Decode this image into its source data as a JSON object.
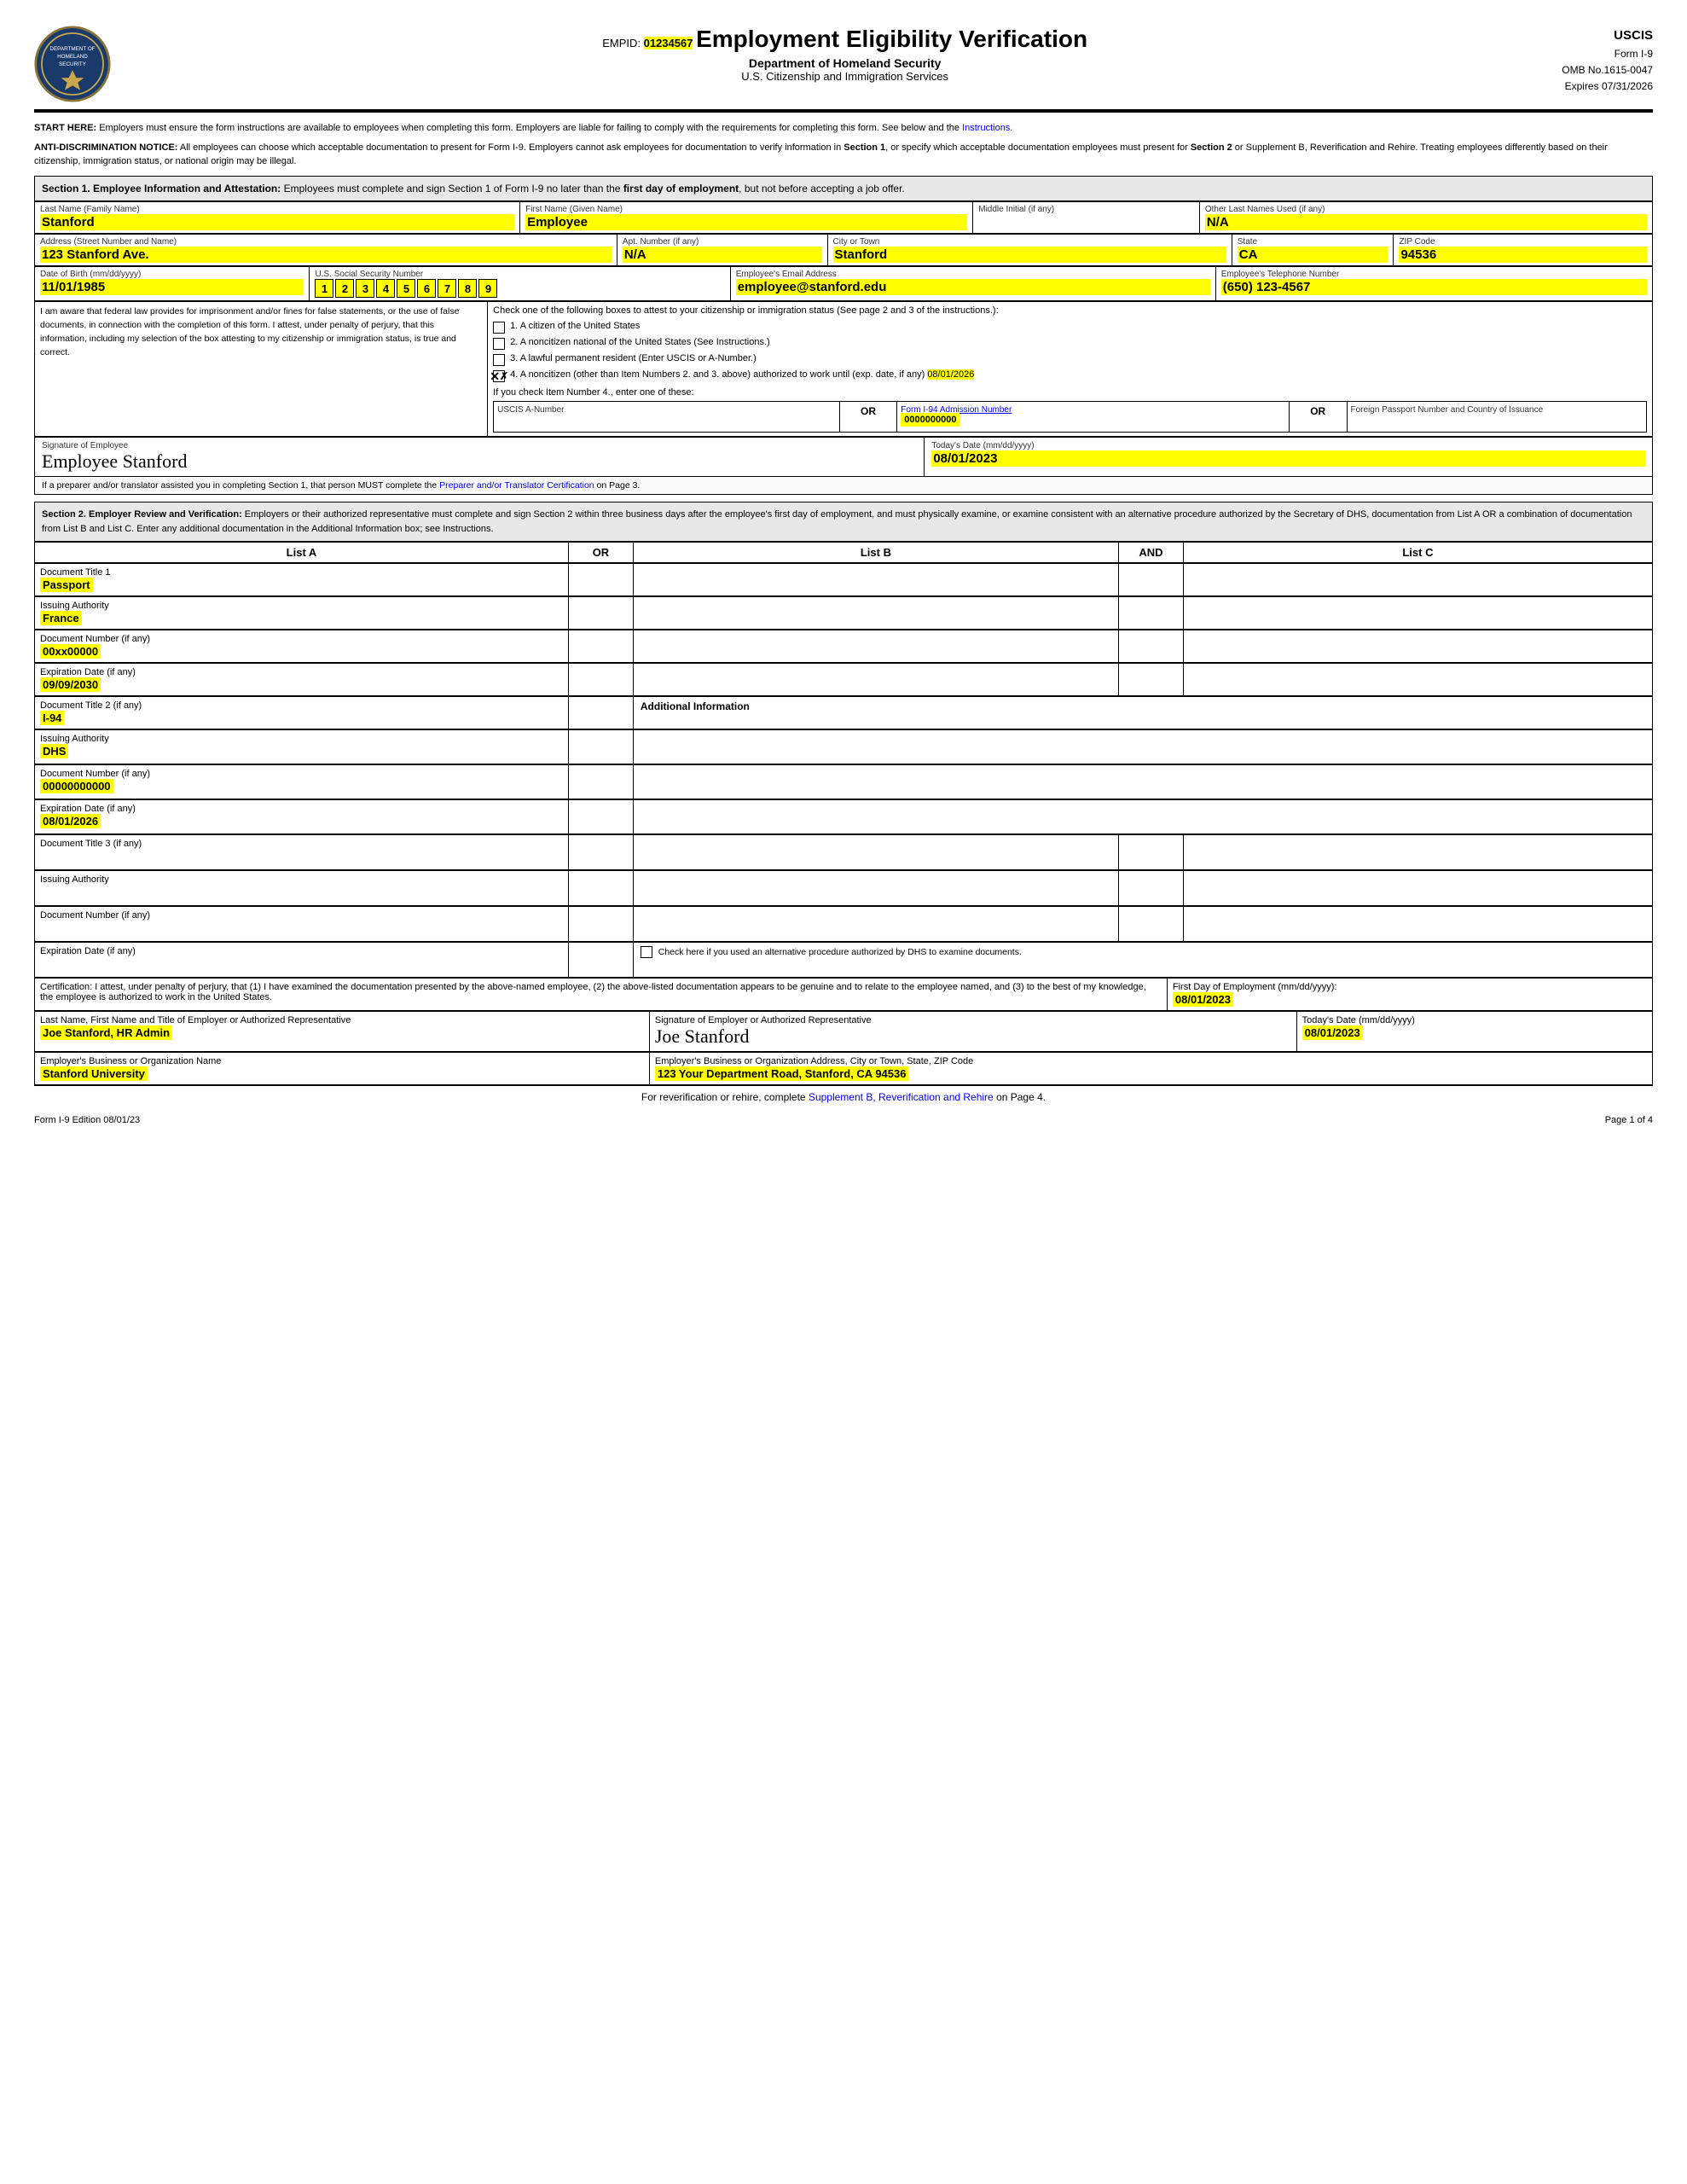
{
  "header": {
    "empid_label": "EMPID:",
    "empid_value": "01234567",
    "form_title": "Employment Eligibility Verification",
    "dept": "Department of Homeland Security",
    "agency": "U.S. Citizenship and Immigration Services",
    "uscis": "USCIS",
    "form_number": "Form I-9",
    "omb": "OMB No.1615-0047",
    "expires": "Expires 07/31/2026"
  },
  "notice": {
    "start_here": "START HERE:  Employers must ensure the form instructions are available to employees when completing this form. Employers are liable for failing to comply with the requirements for completing this form. See below and the Instructions.",
    "anti_discrimination": "ANTI-DISCRIMINATION NOTICE:  All employees can choose which acceptable documentation to present for Form I-9. Employers cannot ask employees for documentation to verify information in Section 1, or specify which acceptable documentation employees must present for Section 2 or Supplement B, Reverification and Rehire. Treating employees differently based on their citizenship, immigration status, or national origin may be illegal."
  },
  "section1": {
    "header": "Section 1. Employee Information and Attestation: Employees must complete and sign Section 1 of Form I-9 no later than the first day of employment, but not before accepting a job offer.",
    "last_name_label": "Last Name (Family Name)",
    "last_name": "Stanford",
    "first_name_label": "First Name (Given Name)",
    "first_name": "Employee",
    "middle_initial_label": "Middle Initial (if any)",
    "middle_initial": "",
    "other_names_label": "Other Last Names Used (if any)",
    "other_names": "N/A",
    "address_label": "Address (Street Number and Name)",
    "address": "123 Stanford Ave.",
    "apt_label": "Apt. Number (if any)",
    "apt": "N/A",
    "city_label": "City or Town",
    "city": "Stanford",
    "state_label": "State",
    "state": "CA",
    "zip_label": "ZIP Code",
    "zip": "94536",
    "dob_label": "Date of Birth (mm/dd/yyyy)",
    "dob": "11/01/1985",
    "ssn_label": "U.S. Social Security Number",
    "ssn_digits": [
      "1",
      "2",
      "3",
      "4",
      "5",
      "6",
      "7",
      "8",
      "9"
    ],
    "email_label": "Employee's Email Address",
    "email": "employee@stanford.edu",
    "phone_label": "Employee's Telephone Number",
    "phone": "(650) 123-4567",
    "attestation_left": "I am aware that federal law provides for imprisonment and/or fines for false statements, or the use of false documents, in connection with the completion of this form. I attest, under penalty of perjury, that this information, including my selection of the box attesting to my citizenship or immigration status, is true and correct.",
    "checkbox1": "1.  A citizen of the United States",
    "checkbox2": "2.  A noncitizen national of the United States (See Instructions.)",
    "checkbox3": "3.  A lawful permanent resident (Enter USCIS or A-Number.)",
    "checkbox4": "4.  A noncitizen (other than Item Numbers 2. and 3. above) authorized to work until (exp. date, if any)",
    "work_until": "08/01/2026",
    "checkbox4_checked": true,
    "if_check4": "If you check Item Number 4., enter one of these:",
    "uscis_a_label": "USCIS A-Number",
    "or1": "OR",
    "form94_label": "Form I-94 Admission Number",
    "form94_value": "0000000000",
    "or2": "OR",
    "passport_label": "Foreign Passport Number and Country of Issuance",
    "sig_label": "Signature of Employee",
    "sig_value": "Employee Stanford",
    "today_label": "Today's Date (mm/dd/yyyy)",
    "today_date": "08/01/2023",
    "preparer_note": "If a preparer and/or translator assisted you in completing Section 1, that person MUST complete the Preparer and/or Translator Certification on Page 3."
  },
  "section2": {
    "header": "Section 2. Employer Review and Verification: Employers or their authorized representative must complete and sign Section 2 within three business days after the employee's first day of employment, and must physically examine, or examine consistent with an alternative procedure authorized by the Secretary of DHS, documentation from List A OR a combination of documentation from List B and List C. Enter any additional documentation in the Additional Information box; see Instructions.",
    "list_a": "List A",
    "list_b": "List B",
    "list_c": "List C",
    "or_label": "OR",
    "and_label": "AND",
    "doc1_title_label": "Document Title 1",
    "doc1_title": "Passport",
    "doc1_issuing_label": "Issuing Authority",
    "doc1_issuing": "France",
    "doc1_number_label": "Document Number (if any)",
    "doc1_number": "00xx00000",
    "doc1_expiry_label": "Expiration Date (if any)",
    "doc1_expiry": "09/09/2030",
    "doc2_title_label": "Document Title 2 (if any)",
    "doc2_title": "I-94",
    "doc2_issuing_label": "Issuing Authority",
    "doc2_issuing": "DHS",
    "doc2_number_label": "Document Number (if any)",
    "doc2_number": "00000000000",
    "doc2_expiry_label": "Expiration Date (if any)",
    "doc2_expiry": "08/01/2026",
    "doc3_title_label": "Document Title 3 (if any)",
    "doc3_title": "",
    "doc3_issuing_label": "Issuing Authority",
    "doc3_issuing": "",
    "doc3_number_label": "Document Number (if any)",
    "doc3_number": "",
    "doc3_expiry_label": "Expiration Date (if any)",
    "doc3_expiry": "",
    "additional_info_header": "Additional Information",
    "alt_procedure_text": "Check here if you used an alternative procedure authorized by DHS to examine documents.",
    "cert_text": "Certification: I attest, under penalty of perjury, that (1) I have examined the documentation presented by the above-named employee, (2) the above-listed documentation appears to be genuine and to relate to the employee named, and (3) to the best of my knowledge, the employee is authorized to work in the United States.",
    "first_day_label": "First Day of Employment (mm/dd/yyyy):",
    "first_day": "08/01/2023",
    "employer_name_label": "Last Name, First Name and Title of Employer or Authorized Representative",
    "employer_name": "Joe Stanford, HR Admin",
    "employer_sig_label": "Signature of Employer or Authorized Representative",
    "employer_sig": "Joe Stanford",
    "employer_date_label": "Today's Date (mm/dd/yyyy)",
    "employer_date": "08/01/2023",
    "org_label": "Employer's Business or Organization Name",
    "org_name": "Stanford University",
    "address_label": "Employer's Business or Organization Address, City or Town, State, ZIP Code",
    "org_address": "123 Your Department Road, Stanford, CA 94536"
  },
  "supplement_footer": "For reverification or rehire, complete Supplement B, Reverification and Rehire on Page 4.",
  "page_footer": {
    "edition": "Form I-9  Edition  08/01/23",
    "page": "Page 1 of 4"
  }
}
